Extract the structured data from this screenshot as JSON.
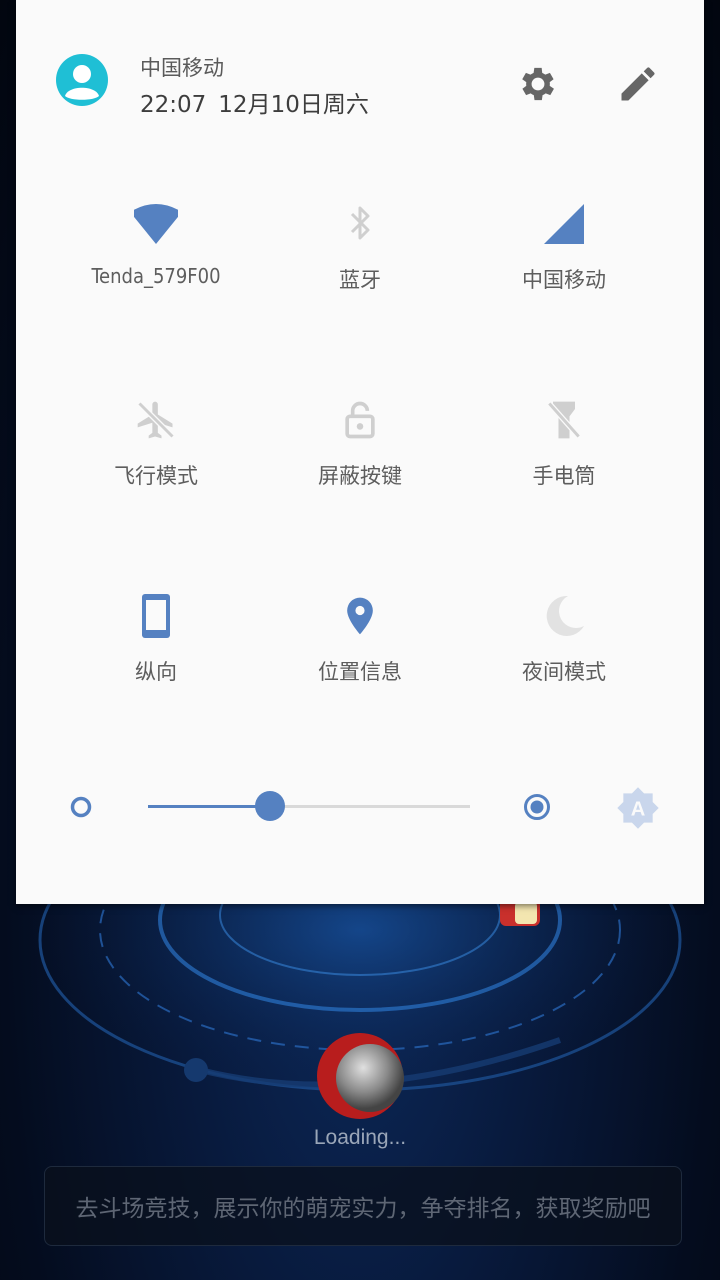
{
  "status": {
    "carrier": "中国移动",
    "time": "22:07",
    "date": "12月10日周六"
  },
  "tiles": [
    {
      "label": "Tenda_579F00",
      "icon": "wifi-icon",
      "active": true
    },
    {
      "label": "蓝牙",
      "icon": "bluetooth-icon",
      "active": false
    },
    {
      "label": "中国移动",
      "icon": "cellular-signal-icon",
      "active": true
    },
    {
      "label": "飞行模式",
      "icon": "airplane-icon",
      "active": false
    },
    {
      "label": "屏蔽按键",
      "icon": "lock-icon",
      "active": false
    },
    {
      "label": "手电筒",
      "icon": "flashlight-icon",
      "active": false
    },
    {
      "label": "纵向",
      "icon": "portrait-phone-icon",
      "active": true
    },
    {
      "label": "位置信息",
      "icon": "location-pin-icon",
      "active": true
    },
    {
      "label": "夜间模式",
      "icon": "moon-icon",
      "active": false
    }
  ],
  "brightness": {
    "level": 0.38,
    "auto": false
  },
  "background_app": {
    "loading_text": "Loading...",
    "tip": "去斗场竞技，展示你的萌宠实力，争夺排名，获取奖励吧"
  },
  "colors": {
    "accent": "#5581c1",
    "inactive": "#cfcfcf",
    "avatar": "#1fbfd5",
    "panel": "#fafafa"
  }
}
